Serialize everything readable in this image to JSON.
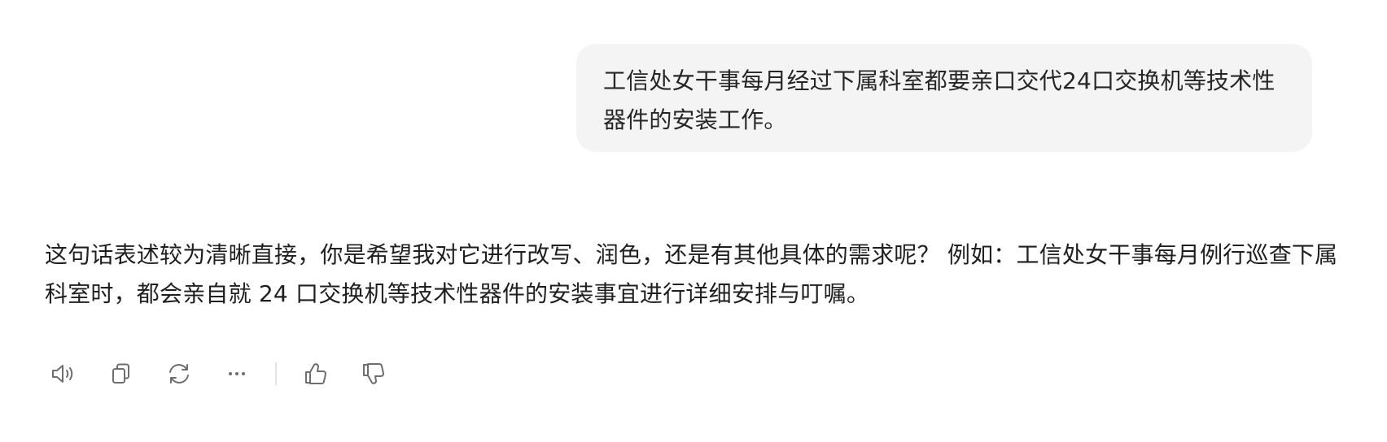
{
  "chat": {
    "user_message": "工信处女干事每月经过下属科室都要亲口交代24口交换机等技术性器件的安装工作。",
    "assistant_message": "这句话表述较为清晰直接，你是希望我对它进行改写、润色，还是有其他具体的需求呢？ 例如：工信处女干事每月例行巡查下属科室时，都会亲自就 24 口交换机等技术性器件的安装事宜进行详细安排与叮嘱。"
  },
  "actions": {
    "icons": [
      "speaker-icon",
      "copy-icon",
      "regenerate-icon",
      "more-icon",
      "thumbs-up-icon",
      "thumbs-down-icon"
    ]
  },
  "colors": {
    "bubble_background": "#f4f4f4",
    "text": "#1f1f1f",
    "icon": "#6e6e6e"
  }
}
